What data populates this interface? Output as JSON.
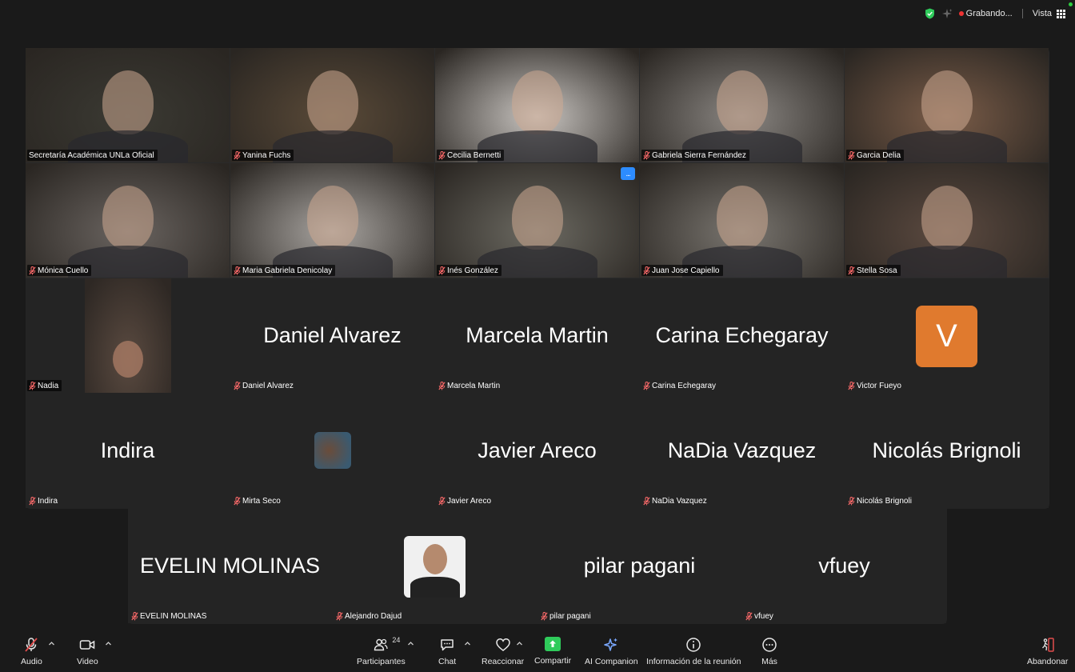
{
  "topbar": {
    "recording_label": "Grabando...",
    "view_label": "Vista",
    "icons": [
      "shield-check-icon",
      "sparkle-icon",
      "recording-dot-icon",
      "grid-view-icon"
    ]
  },
  "colors": {
    "background": "#1a1a1a",
    "tile": "#242424",
    "active_speaker_border": "#3ec248",
    "avatar_orange": "#e07a2e",
    "share_green": "#2fcb5b",
    "muted_red": "#e24c4c"
  },
  "participants": [
    {
      "name": "Secretaría Académica UNLa Oficial",
      "video": true,
      "muted": false,
      "active": true
    },
    {
      "name": "Yanina Fuchs",
      "video": true,
      "muted": true
    },
    {
      "name": "Cecilia Bernetti",
      "video": true,
      "muted": true
    },
    {
      "name": "Gabriela Sierra Fernández",
      "video": true,
      "muted": true
    },
    {
      "name": "Garcia Delia",
      "video": true,
      "muted": true
    },
    {
      "name": "Mónica Cuello",
      "video": true,
      "muted": true
    },
    {
      "name": "Maria Gabriela Denicolay",
      "video": true,
      "muted": true
    },
    {
      "name": "Inés González",
      "video": true,
      "muted": true,
      "more_menu": "..."
    },
    {
      "name": "Juan Jose Capiello",
      "video": true,
      "muted": true
    },
    {
      "name": "Stella Sosa",
      "video": true,
      "muted": true
    },
    {
      "name": "Nadia",
      "video": true,
      "muted": true
    },
    {
      "name": "Daniel Alvarez",
      "display": "Daniel Alvarez",
      "video": false,
      "muted": true
    },
    {
      "name": "Marcela Martin",
      "display": "Marcela Martin",
      "video": false,
      "muted": true
    },
    {
      "name": "Carina Echegaray",
      "display": "Carina Echegaray",
      "video": false,
      "muted": true
    },
    {
      "name": "Victor Fueyo",
      "avatar_letter": "V",
      "video": false,
      "muted": true
    },
    {
      "name": "Indira",
      "display": "Indira",
      "video": false,
      "muted": true
    },
    {
      "name": "Mirta Seco",
      "video": false,
      "muted": true
    },
    {
      "name": "Javier Areco",
      "display": "Javier Areco",
      "video": false,
      "muted": true
    },
    {
      "name": "NaDia Vazquez",
      "display": "NaDia Vazquez",
      "video": false,
      "muted": true
    },
    {
      "name": "Nicolás Brignoli",
      "display": "Nicolás Brignoli",
      "video": false,
      "muted": true
    },
    {
      "name": "EVELIN MOLINAS",
      "display": "EVELIN MOLINAS",
      "video": false,
      "muted": true
    },
    {
      "name": "Alejandro Dajud",
      "video": false,
      "muted": true
    },
    {
      "name": "pilar pagani",
      "display": "pilar pagani",
      "video": false,
      "muted": true
    },
    {
      "name": "vfuey",
      "display": "vfuey",
      "video": false,
      "muted": true
    }
  ],
  "toolbar": {
    "audio": "Audio",
    "video": "Video",
    "participants": "Participantes",
    "participants_count": "24",
    "chat": "Chat",
    "react": "Reaccionar",
    "share": "Compartir",
    "ai": "AI Companion",
    "info": "Información de la reunión",
    "more": "Más",
    "leave": "Abandonar"
  }
}
